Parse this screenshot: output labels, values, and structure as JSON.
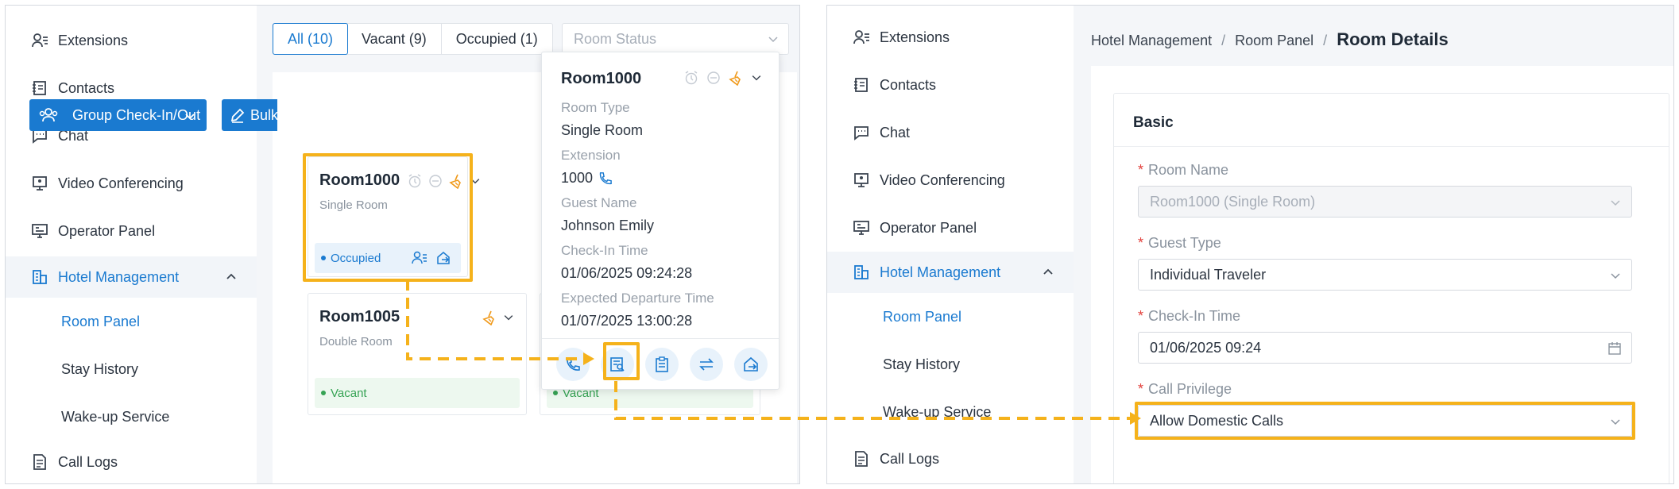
{
  "sidebar_left": {
    "items": [
      {
        "label": "Extensions",
        "icon": "contact-list-icon"
      },
      {
        "label": "Contacts",
        "icon": "address-book-icon"
      },
      {
        "label": "Chat",
        "icon": "chat-bubble-icon"
      },
      {
        "label": "Video Conferencing",
        "icon": "monitor-icon"
      },
      {
        "label": "Operator Panel",
        "icon": "console-icon"
      },
      {
        "label": "Hotel Management",
        "icon": "building-icon"
      },
      {
        "label": "Room Panel"
      },
      {
        "label": "Stay History"
      },
      {
        "label": "Wake-up Service"
      },
      {
        "label": "Call Logs",
        "icon": "document-icon"
      }
    ]
  },
  "filters": {
    "tabs": [
      "All (10)",
      "Vacant (9)",
      "Occupied (1)"
    ],
    "room_status_placeholder": "Room Status"
  },
  "toolbar": {
    "group_label": "Group Check-In/Out",
    "bulk_label": "Bulk"
  },
  "rooms": [
    {
      "name": "Room1000",
      "type": "Single Room",
      "status": "Occupied"
    },
    {
      "name": "Room1005",
      "type": "Double Room",
      "status": "Vacant"
    },
    {
      "status": "Vacant"
    }
  ],
  "popover": {
    "title": "Room1000",
    "room_type_label": "Room Type",
    "room_type_value": "Single Room",
    "extension_label": "Extension",
    "extension_value": "1000",
    "guest_label": "Guest Name",
    "guest_value": "Johnson Emily",
    "checkin_label": "Check-In Time",
    "checkin_value": "01/06/2025 09:24:28",
    "departure_label": "Expected Departure Time",
    "departure_value": "01/07/2025 13:00:28"
  },
  "sidebar_right": {
    "items": [
      {
        "label": "Extensions"
      },
      {
        "label": "Contacts"
      },
      {
        "label": "Chat"
      },
      {
        "label": "Video Conferencing"
      },
      {
        "label": "Operator Panel"
      },
      {
        "label": "Hotel Management"
      },
      {
        "label": "Room Panel"
      },
      {
        "label": "Stay History"
      },
      {
        "label": "Wake-up Service"
      },
      {
        "label": "Call Logs"
      }
    ]
  },
  "breadcrumb": {
    "level1": "Hotel Management",
    "level2": "Room Panel",
    "current": "Room Details",
    "separator": "/"
  },
  "form": {
    "section": "Basic",
    "required_mark": "*",
    "room_name_label": "Room Name",
    "room_name_value": "Room1000 (Single Room)",
    "guest_type_label": "Guest Type",
    "guest_type_value": "Individual Traveler",
    "checkin_label": "Check-In Time",
    "checkin_value": "01/06/2025 09:24",
    "privilege_label": "Call Privilege",
    "privilege_value": "Allow Domestic Calls"
  },
  "colors": {
    "accent": "#1a7ad0",
    "highlight": "#f5b21b",
    "vacant": "#36a354",
    "required": "#e2403c"
  }
}
